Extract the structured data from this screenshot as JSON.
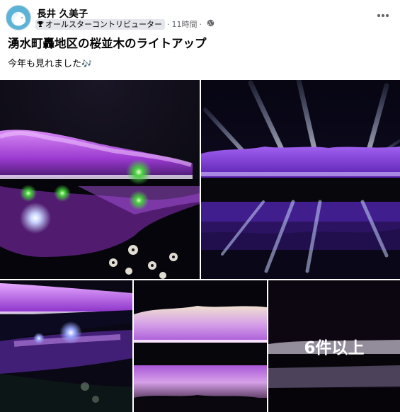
{
  "post": {
    "author": "長井 久美子",
    "badge_label": "オールスターコントリビューター",
    "separator": "·",
    "time": "11時間",
    "separator2": "·",
    "title": "湧水町轟地区の桜並木のライトアップ",
    "body_text": "今年も見れました",
    "body_emoji": "🎶"
  },
  "photos": {
    "more_label": "6件以上"
  },
  "icons": {
    "badge": "trophy-icon",
    "privacy": "globe-icon",
    "menu": "more-horizontal-icon",
    "avatar": "dog-avatar"
  },
  "colors": {
    "author_text": "#050505",
    "meta_text": "#65676b",
    "badge_bg": "#e4e6eb",
    "photo_purple": "#b04be0"
  }
}
